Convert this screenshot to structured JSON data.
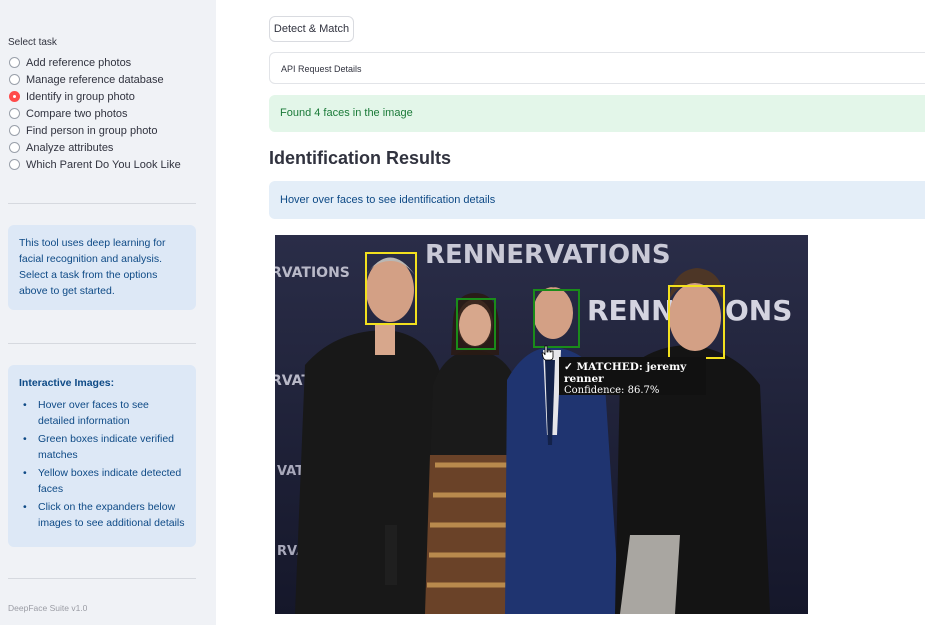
{
  "sidebar": {
    "task_label": "Select task",
    "options": [
      {
        "label": "Add reference photos",
        "selected": false
      },
      {
        "label": "Manage reference database",
        "selected": false
      },
      {
        "label": "Identify in group photo",
        "selected": true
      },
      {
        "label": "Compare two photos",
        "selected": false
      },
      {
        "label": "Find person in group photo",
        "selected": false
      },
      {
        "label": "Analyze attributes",
        "selected": false
      },
      {
        "label": "Which Parent Do You Look Like",
        "selected": false
      }
    ],
    "info_text": "This tool uses deep learning for facial recognition and analysis. Select a task from the options above to get started.",
    "interactive": {
      "title": "Interactive Images:",
      "bullets": [
        "Hover over faces to see detailed information",
        "Green boxes indicate verified matches",
        "Yellow boxes indicate detected faces",
        "Click on the expanders below images to see additional details"
      ]
    },
    "footer": "DeepFace Suite v1.0"
  },
  "main": {
    "detect_button": "Detect & Match",
    "expander_label": "API Request Details",
    "success_message": "Found 4 faces in the image",
    "heading": "Identification Results",
    "hover_info": "Hover over faces to see identification details"
  },
  "photo": {
    "backdrop_text": {
      "top": "RENNERVATIONS",
      "right_1": "RENNER",
      "right_2": "ONS",
      "left_1": "RVATIONS",
      "left_2": "RVATIONS"
    },
    "faces": [
      {
        "name": "face-1",
        "color": "yellow"
      },
      {
        "name": "face-2",
        "color": "green"
      },
      {
        "name": "face-3",
        "color": "green"
      },
      {
        "name": "face-4",
        "color": "yellow"
      }
    ],
    "tooltip": {
      "match": "✓ MATCHED: jeremy renner",
      "confidence": "Confidence: 86.7%"
    }
  },
  "colors": {
    "yellow_box": "#f2e01e",
    "green_box": "#1a8c1a",
    "radio_selected": "#ff4b4b",
    "success_bg": "#e3f6e9",
    "info_bg": "#e4eef8"
  }
}
